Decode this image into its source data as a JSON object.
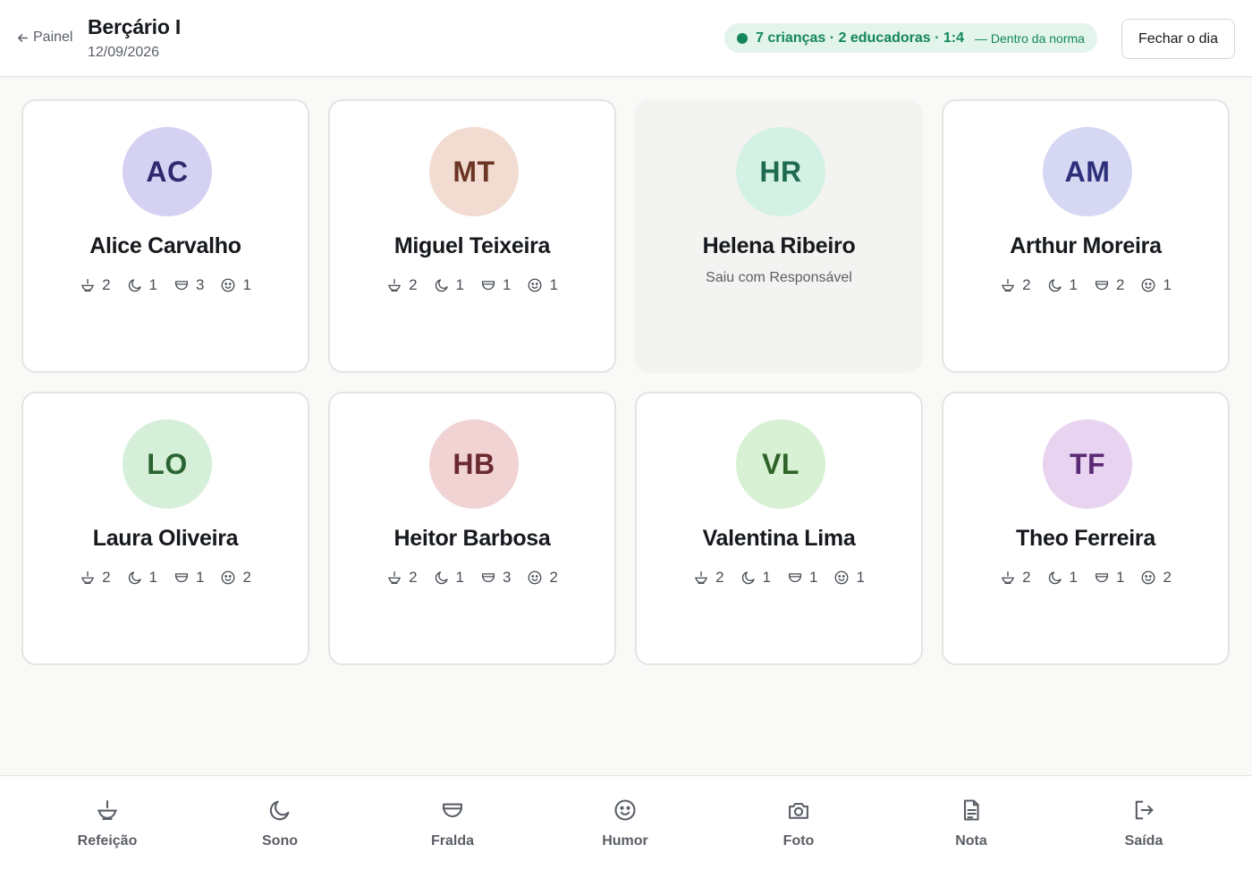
{
  "header": {
    "back_label": "Painel",
    "room_title": "Berçário I",
    "date": "12/09/2026",
    "ratio_text": "7 crianças · 2 educadoras · 1:4",
    "ratio_norm": "— Dentro da norma",
    "close_day_label": "Fechar o dia"
  },
  "colors": {
    "ratio_ok": "#14865c",
    "ratio_bg": "#e2f4ec"
  },
  "children": [
    {
      "initials": "AC",
      "name": "Alice Carvalho",
      "avatar_bg": "#d4d1f3",
      "avatar_fg": "#2e2a6e",
      "meals": "2",
      "sleep": "1",
      "diaper": "3",
      "mood": "1"
    },
    {
      "initials": "MT",
      "name": "Miguel Teixeira",
      "avatar_bg": "#f2dcd2",
      "avatar_fg": "#6b3424",
      "meals": "2",
      "sleep": "1",
      "diaper": "1",
      "mood": "1"
    },
    {
      "initials": "HR",
      "name": "Helena Ribeiro",
      "avatar_bg": "#d3f1e5",
      "avatar_fg": "#1f6b50",
      "status": "Saiu com Responsável"
    },
    {
      "initials": "AM",
      "name": "Arthur Moreira",
      "avatar_bg": "#d6d7f3",
      "avatar_fg": "#2c2f7a",
      "meals": "2",
      "sleep": "1",
      "diaper": "2",
      "mood": "1"
    },
    {
      "initials": "LO",
      "name": "Laura Oliveira",
      "avatar_bg": "#d5efd8",
      "avatar_fg": "#2b6430",
      "meals": "2",
      "sleep": "1",
      "diaper": "1",
      "mood": "2"
    },
    {
      "initials": "HB",
      "name": "Heitor Barbosa",
      "avatar_bg": "#f1d3d3",
      "avatar_fg": "#6b2a2f",
      "meals": "2",
      "sleep": "1",
      "diaper": "3",
      "mood": "2"
    },
    {
      "initials": "VL",
      "name": "Valentina Lima",
      "avatar_bg": "#d8f0d4",
      "avatar_fg": "#2e6428",
      "meals": "2",
      "sleep": "1",
      "diaper": "1",
      "mood": "1"
    },
    {
      "initials": "TF",
      "name": "Theo Ferreira",
      "avatar_bg": "#e8d3f1",
      "avatar_fg": "#5a2a74",
      "meals": "2",
      "sleep": "1",
      "diaper": "1",
      "mood": "2"
    }
  ],
  "actions": [
    {
      "label": "Refeição",
      "icon": "meal-icon"
    },
    {
      "label": "Sono",
      "icon": "moon-icon"
    },
    {
      "label": "Fralda",
      "icon": "diaper-icon"
    },
    {
      "label": "Humor",
      "icon": "smiley-icon"
    },
    {
      "label": "Foto",
      "icon": "camera-icon"
    },
    {
      "label": "Nota",
      "icon": "document-icon"
    },
    {
      "label": "Saída",
      "icon": "exit-icon"
    }
  ]
}
